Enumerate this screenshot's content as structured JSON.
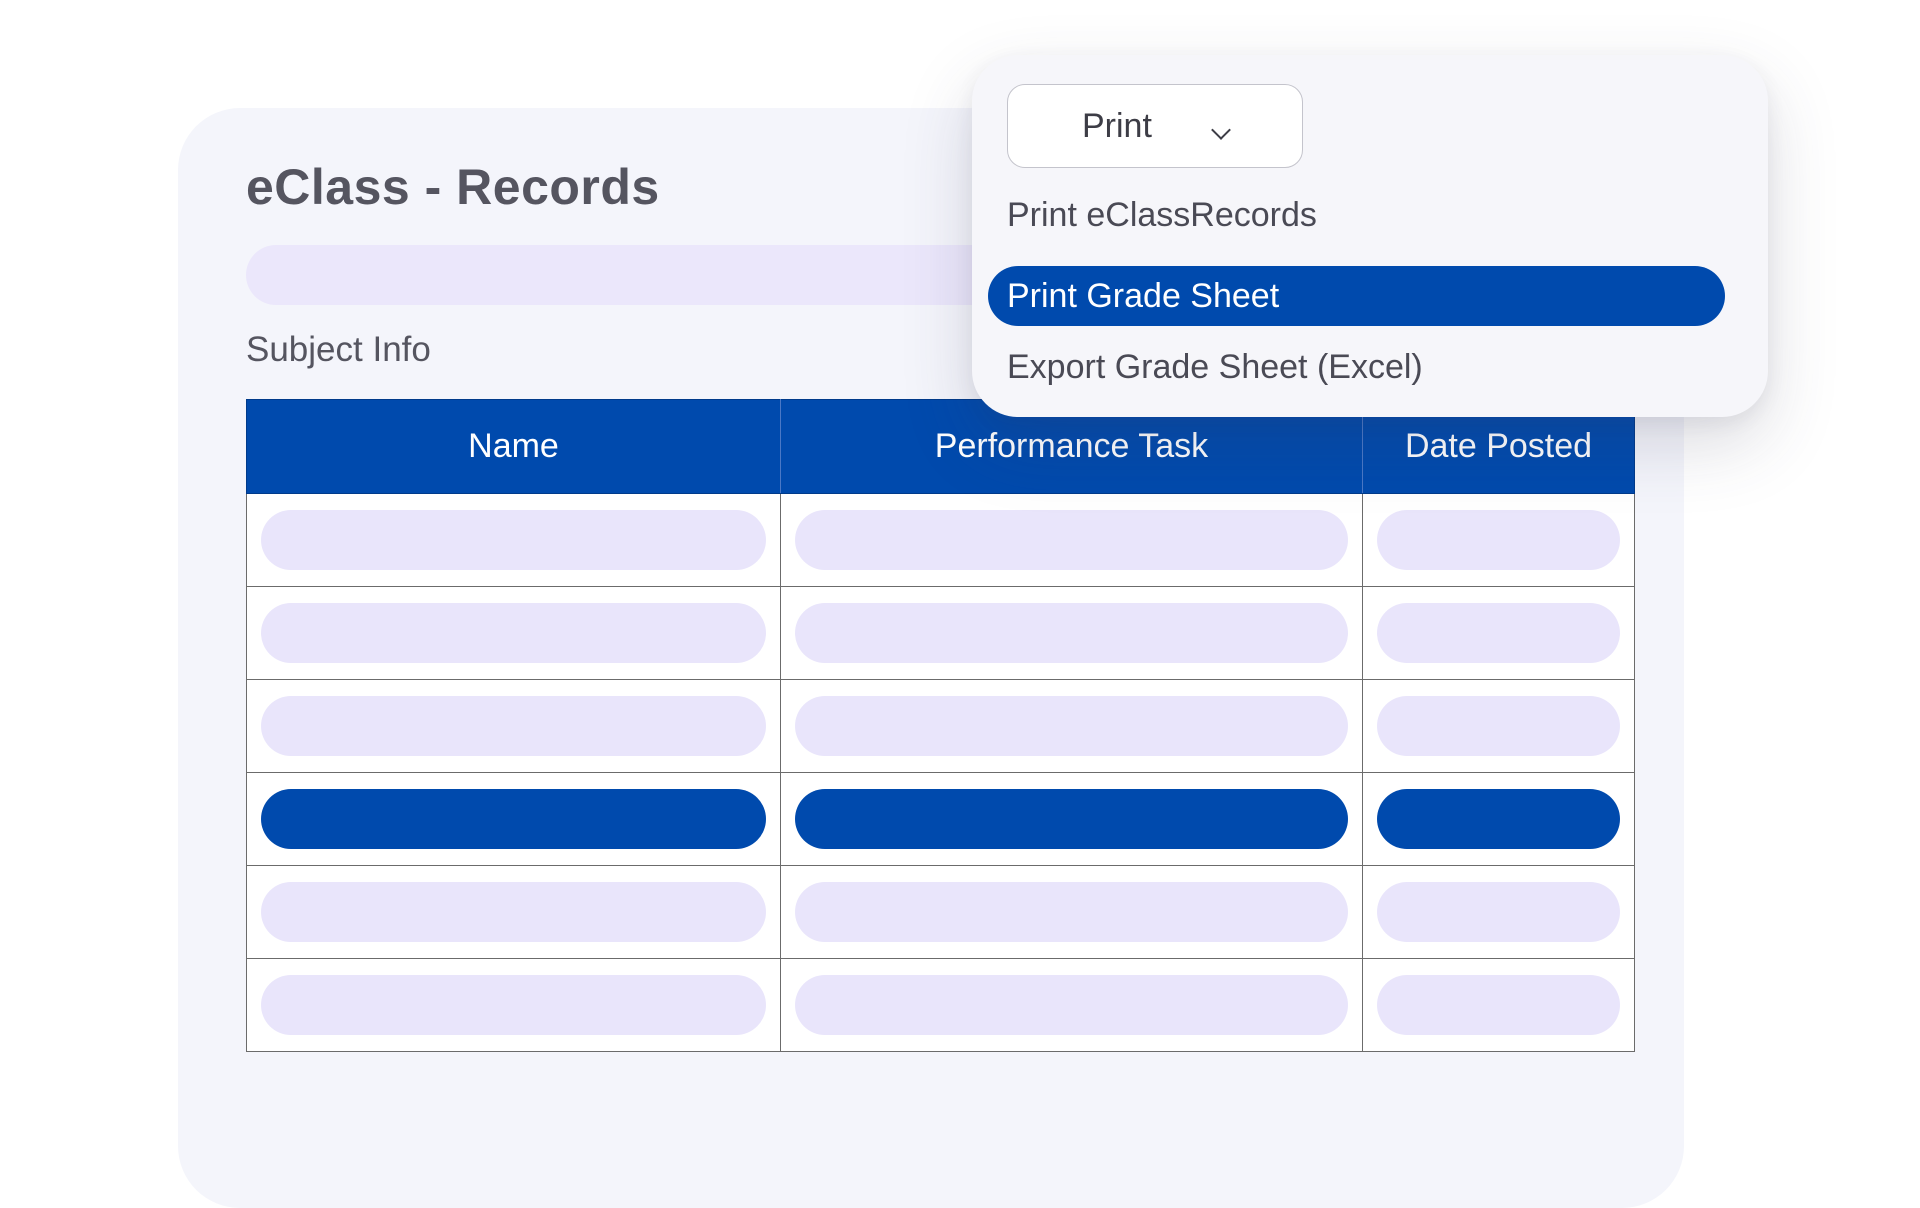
{
  "page": {
    "title": "eClass - Records",
    "section_label": "Subject Info"
  },
  "table": {
    "columns": [
      "Name",
      "Performance Task",
      "Date Posted"
    ],
    "row_count": 6,
    "selected_row": 4
  },
  "print_menu": {
    "select_label": "Print",
    "items": [
      "Print eClassRecords",
      "Print Grade Sheet",
      "Export Grade Sheet (Excel)"
    ],
    "highlighted_item": "Print Grade Sheet"
  },
  "colors": {
    "accent": "#004aad",
    "placeholder": "#e9e5fb",
    "card_background": "#f4f5fb"
  },
  "icons": {
    "dropdown_indicator": "chevron-down-icon"
  }
}
